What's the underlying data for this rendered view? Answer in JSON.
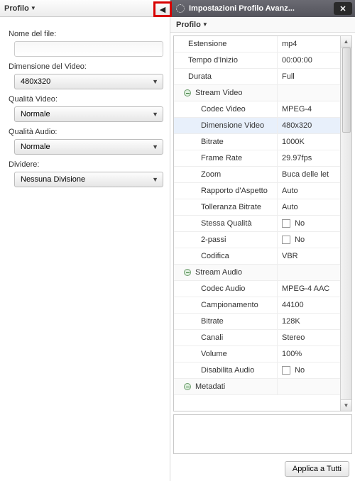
{
  "left": {
    "header": "Profilo",
    "filename_label": "Nome del file:",
    "filename_value": "",
    "videosize_label": "Dimensione del Video:",
    "videosize_value": "480x320",
    "vq_label": "Qualità Video:",
    "vq_value": "Normale",
    "aq_label": "Qualità Audio:",
    "aq_value": "Normale",
    "split_label": "Dividere:",
    "split_value": "Nessuna Divisione"
  },
  "right": {
    "title": "Impostazioni Profilo Avanz...",
    "sub": "Profilo",
    "apply": "Applica a Tutti",
    "rows": [
      {
        "k": "Estensione",
        "v": "mp4",
        "t": "plain"
      },
      {
        "k": "Tempo d'Inizio",
        "v": "00:00:00",
        "t": "plain"
      },
      {
        "k": "Durata",
        "v": "Full",
        "t": "plain"
      },
      {
        "k": "Stream Video",
        "v": "",
        "t": "group"
      },
      {
        "k": "Codec Video",
        "v": "MPEG-4",
        "t": "indent"
      },
      {
        "k": "Dimensione Video",
        "v": "480x320",
        "t": "indent-sel"
      },
      {
        "k": "Bitrate",
        "v": "1000K",
        "t": "indent"
      },
      {
        "k": "Frame Rate",
        "v": "29.97fps",
        "t": "indent"
      },
      {
        "k": "Zoom",
        "v": "Buca delle let",
        "t": "indent"
      },
      {
        "k": "Rapporto d'Aspetto",
        "v": "Auto",
        "t": "indent"
      },
      {
        "k": "Tolleranza Bitrate",
        "v": "Auto",
        "t": "indent"
      },
      {
        "k": "Stessa Qualità",
        "v": "No",
        "t": "indent-cb"
      },
      {
        "k": "2-passi",
        "v": "No",
        "t": "indent-cb"
      },
      {
        "k": "Codifica",
        "v": "VBR",
        "t": "indent"
      },
      {
        "k": "Stream Audio",
        "v": "",
        "t": "group"
      },
      {
        "k": "Codec Audio",
        "v": "MPEG-4 AAC",
        "t": "indent"
      },
      {
        "k": "Campionamento",
        "v": "44100",
        "t": "indent"
      },
      {
        "k": "Bitrate",
        "v": "128K",
        "t": "indent"
      },
      {
        "k": "Canali",
        "v": "Stereo",
        "t": "indent"
      },
      {
        "k": "Volume",
        "v": "100%",
        "t": "indent"
      },
      {
        "k": "Disabilita Audio",
        "v": "No",
        "t": "indent-cb"
      },
      {
        "k": "Metadati",
        "v": "",
        "t": "group"
      }
    ]
  }
}
